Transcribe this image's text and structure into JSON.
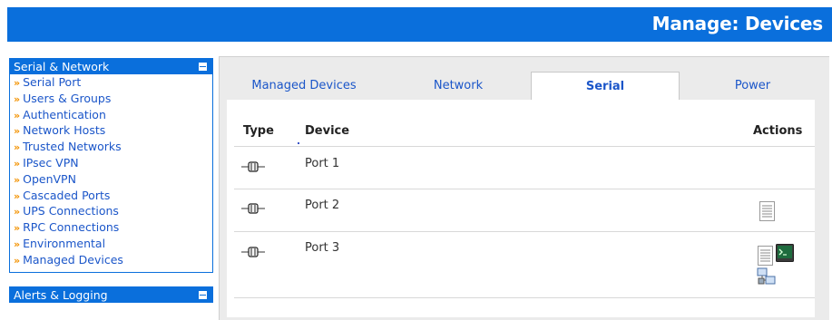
{
  "header": {
    "title": "Manage: Devices"
  },
  "colors": {
    "brand_blue": "#0a6fdc",
    "link_blue": "#1b56c9",
    "bullet_orange": "#f39200"
  },
  "sidebar": {
    "sections": [
      {
        "title": "Serial & Network",
        "items": [
          {
            "label": "Serial Port"
          },
          {
            "label": "Users & Groups"
          },
          {
            "label": "Authentication"
          },
          {
            "label": "Network Hosts"
          },
          {
            "label": "Trusted Networks"
          },
          {
            "label": "IPsec VPN"
          },
          {
            "label": "OpenVPN"
          },
          {
            "label": "Cascaded Ports"
          },
          {
            "label": "UPS Connections"
          },
          {
            "label": "RPC Connections"
          },
          {
            "label": "Environmental"
          },
          {
            "label": "Managed Devices"
          }
        ]
      },
      {
        "title": "Alerts & Logging",
        "items": []
      }
    ],
    "bullet": "»"
  },
  "tabs": [
    {
      "label": "Managed Devices",
      "active": false
    },
    {
      "label": "Network",
      "active": false
    },
    {
      "label": "Serial",
      "active": true
    },
    {
      "label": "Power",
      "active": false
    }
  ],
  "table": {
    "columns": {
      "type": "Type",
      "device": "Device",
      "actions": "Actions"
    },
    "rows": [
      {
        "device": "Port 1",
        "icon": "serial-port-icon",
        "actions": []
      },
      {
        "device": "Port 2",
        "icon": "serial-port-icon",
        "actions": [
          "document-icon"
        ]
      },
      {
        "device": "Port 3",
        "icon": "serial-port-icon",
        "actions": [
          "document-icon",
          "terminal-icon",
          "network-icon"
        ]
      }
    ]
  }
}
